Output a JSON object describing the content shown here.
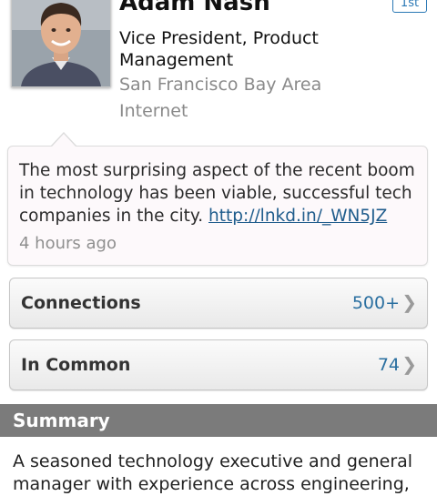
{
  "profile": {
    "name": "Adam Nash",
    "degree": "1st",
    "title": "Vice President, Product Management",
    "location": "San Francisco Bay Area",
    "industry": "Internet"
  },
  "share": {
    "text": "The most surprising aspect of the recent boom in technology has been viable, successful tech companies in the city.",
    "link": "http://lnkd.in/_WN5JZ",
    "time": "4 hours ago"
  },
  "rows": {
    "connections": {
      "label": "Connections",
      "count": "500+"
    },
    "in_common": {
      "label": "In Common",
      "count": "74"
    }
  },
  "summary": {
    "header": "Summary",
    "text": "A seasoned technology executive and general manager with experience across engineering,"
  },
  "colors": {
    "link": "#1f5c8c",
    "count": "#2a6fa0",
    "section_header": "#7b7b7b"
  }
}
